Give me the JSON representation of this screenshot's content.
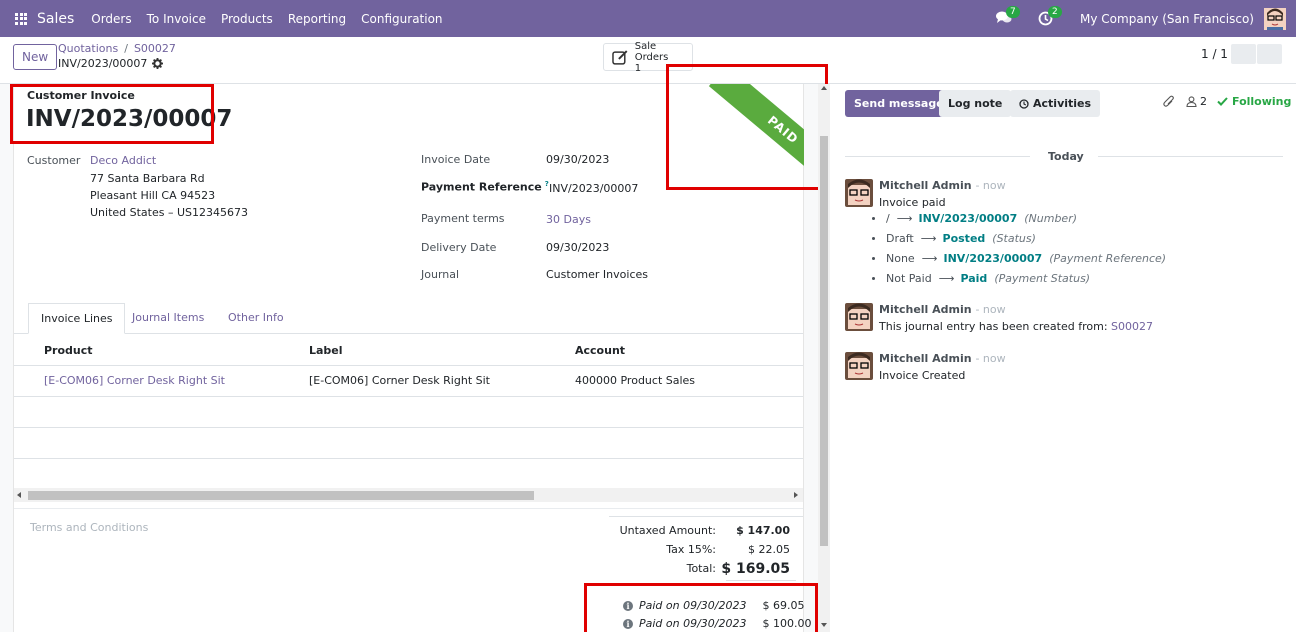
{
  "navbar": {
    "app_name": "Sales",
    "menu": [
      "Orders",
      "To Invoice",
      "Products",
      "Reporting",
      "Configuration"
    ],
    "messages_count": "7",
    "activities_count": "2",
    "company": "My Company (San Francisco)"
  },
  "control": {
    "new_label": "New",
    "breadcrumb": [
      "Quotations",
      "S00027"
    ],
    "record_name": "INV/2023/00007",
    "smart_button": {
      "label": "Sale Orders",
      "count": "1"
    },
    "pager": "1 / 1"
  },
  "form": {
    "doc_type": "Customer Invoice",
    "doc_number": "INV/2023/00007",
    "ribbon": "PAID",
    "customer_label": "Customer",
    "customer_name": "Deco Addict",
    "customer_address": [
      "77 Santa Barbara Rd",
      "Pleasant Hill CA 94523",
      "United States – US12345673"
    ],
    "invoice_date_label": "Invoice Date",
    "invoice_date": "09/30/2023",
    "payment_ref_label": "Payment Reference",
    "payment_ref_tooltip": "?",
    "payment_ref": "INV/2023/00007",
    "payment_terms_label": "Payment terms",
    "payment_terms": "30 Days",
    "delivery_date_label": "Delivery Date",
    "delivery_date": "09/30/2023",
    "journal_label": "Journal",
    "journal": "Customer Invoices"
  },
  "tabs": [
    "Invoice Lines",
    "Journal Items",
    "Other Info"
  ],
  "lines": {
    "headers": [
      "Product",
      "Label",
      "Account"
    ],
    "rows": [
      {
        "product": "[E-COM06] Corner Desk Right Sit",
        "label": "[E-COM06] Corner Desk Right Sit",
        "account": "400000 Product Sales"
      }
    ]
  },
  "terms_placeholder": "Terms and Conditions",
  "totals": {
    "untaxed_label": "Untaxed Amount:",
    "untaxed": "$ 147.00",
    "tax_label": "Tax 15%:",
    "tax": "$ 22.05",
    "total_label": "Total:",
    "total": "$ 169.05",
    "payments": [
      {
        "when": "Paid on 09/30/2023",
        "amount": "$ 69.05"
      },
      {
        "when": "Paid on 09/30/2023",
        "amount": "$ 100.00"
      }
    ]
  },
  "chatter": {
    "send_message": "Send message",
    "log_note": "Log note",
    "activities": "Activities",
    "followers_count": "2",
    "following": "Following",
    "today": "Today",
    "messages": [
      {
        "author": "Mitchell Admin",
        "time": "- now",
        "body": "Invoice paid",
        "tracking": [
          {
            "old": "/",
            "new": "INV/2023/00007",
            "field": "(Number)"
          },
          {
            "old": "Draft",
            "new": "Posted",
            "field": "(Status)"
          },
          {
            "old": "None",
            "new": "INV/2023/00007",
            "field": "(Payment Reference)"
          },
          {
            "old": "Not Paid",
            "new": "Paid",
            "field": "(Payment Status)"
          }
        ]
      },
      {
        "author": "Mitchell Admin",
        "time": "- now",
        "body": "This journal entry has been created from:",
        "body_link": "S00027"
      },
      {
        "author": "Mitchell Admin",
        "time": "- now",
        "body": "Invoice Created"
      }
    ]
  },
  "colors": {
    "brand": "#71639e",
    "paid_ribbon": "#5aab3e",
    "highlight_box": "#e00000",
    "tracking_new": "#017e84"
  }
}
